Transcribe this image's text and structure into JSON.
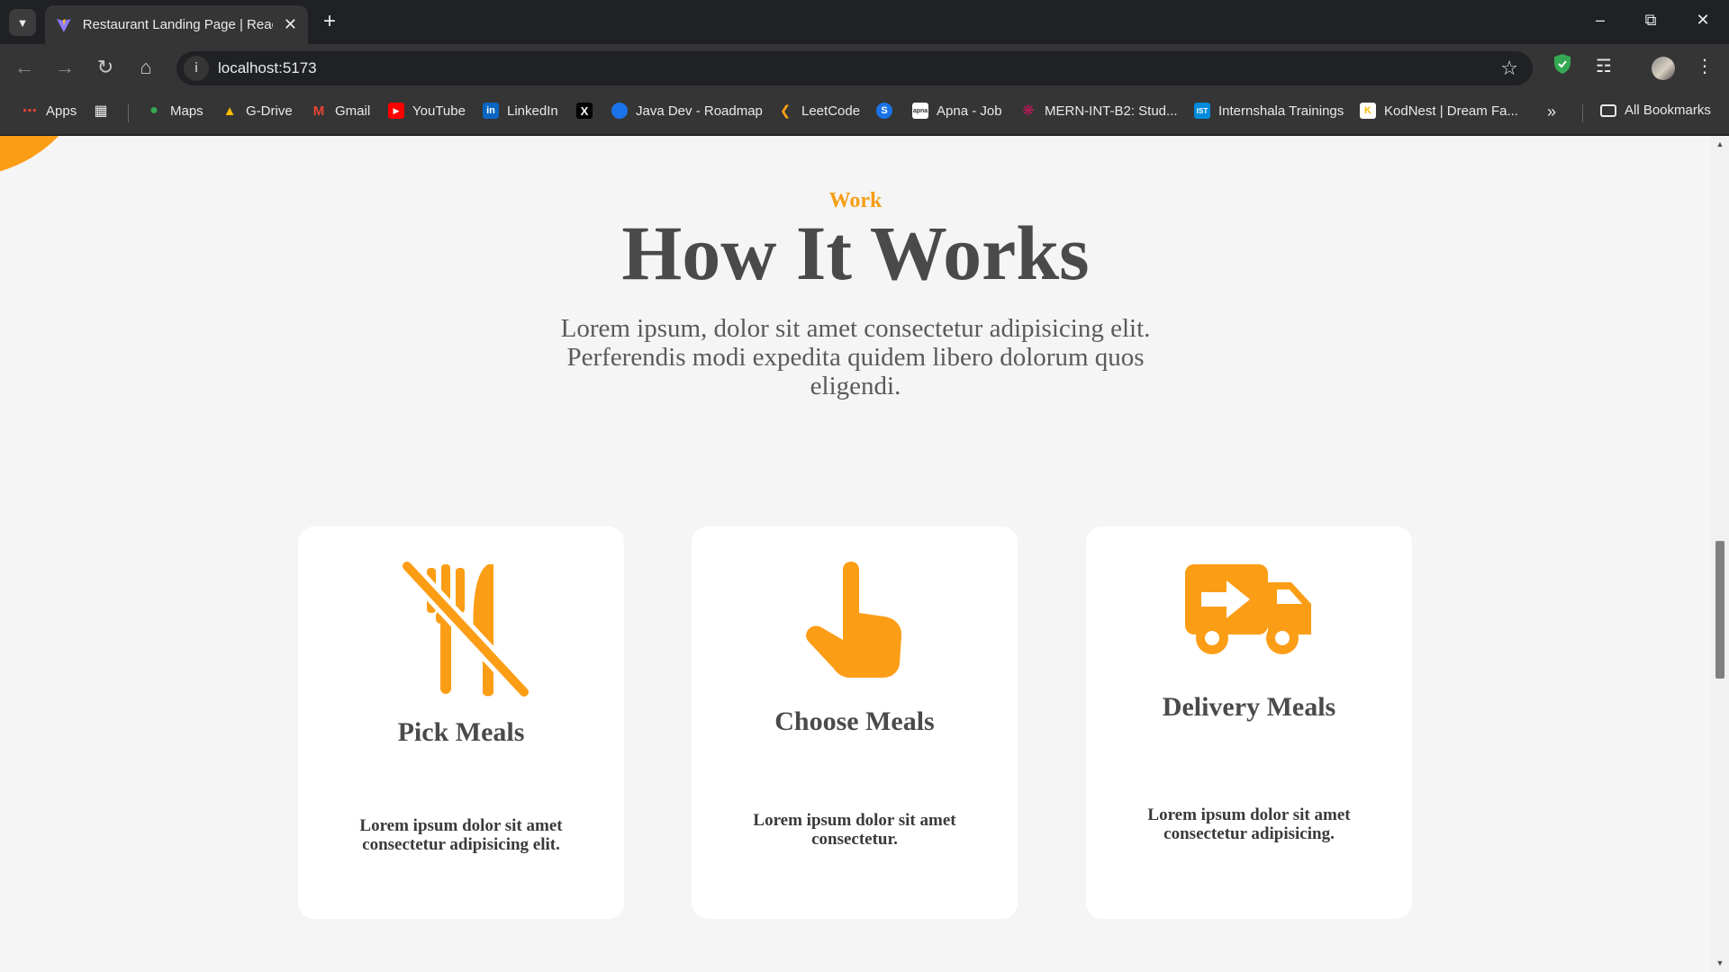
{
  "browser": {
    "tab_title": "Restaurant Landing Page | React",
    "url": "localhost:5173",
    "bookmarks": [
      {
        "label": "Apps",
        "icon": "apps-grid-icon",
        "color": "#e8eaed"
      },
      {
        "label": "Maps",
        "icon": "maps-pin-icon",
        "color": "#ea4335"
      },
      {
        "label": "G-Drive",
        "icon": "google-drive-icon",
        "color": "#34a853"
      },
      {
        "label": "Gmail",
        "icon": "gmail-icon",
        "color": "#ea4335"
      },
      {
        "label": "YouTube",
        "icon": "youtube-icon",
        "color": "#ff0000"
      },
      {
        "label": "LinkedIn",
        "icon": "linkedin-icon",
        "color": "#0a66c2"
      },
      {
        "label": "Java Dev - Roadmap",
        "icon": "roadmap-icon",
        "color": "#1a73e8"
      },
      {
        "label": "LeetCode",
        "icon": "leetcode-icon",
        "color": "#ffa116"
      },
      {
        "label": "Apna - Job",
        "icon": "apna-icon",
        "color": "#ffffff"
      },
      {
        "label": "MERN-INT-B2: Stud...",
        "icon": "mern-icon",
        "color": "#c2185b"
      },
      {
        "label": "Internshala Trainings",
        "icon": "internshala-icon",
        "color": "#008bdc"
      },
      {
        "label": "KodNest | Dream Fa...",
        "icon": "kodnest-icon",
        "color": "#fbbc04"
      }
    ],
    "all_bookmarks": "All Bookmarks"
  },
  "page": {
    "accent_color": "#fc9d16",
    "section_tag": "Work",
    "section_title": "How It Works",
    "section_desc": "Lorem ipsum, dolor sit amet consectetur adipisicing elit. Perferendis modi expedita quidem libero dolorum quos eligendi.",
    "cards": [
      {
        "icon": "utensils-slash-icon",
        "title": "Pick Meals",
        "text": "Lorem ipsum dolor sit amet consectetur adipisicing elit."
      },
      {
        "icon": "hand-pointer-icon",
        "title": "Choose Meals",
        "text": "Lorem ipsum dolor sit amet consectetur."
      },
      {
        "icon": "delivery-truck-icon",
        "title": "Delivery Meals",
        "text": "Lorem ipsum dolor sit amet consectetur adipisicing."
      }
    ]
  }
}
